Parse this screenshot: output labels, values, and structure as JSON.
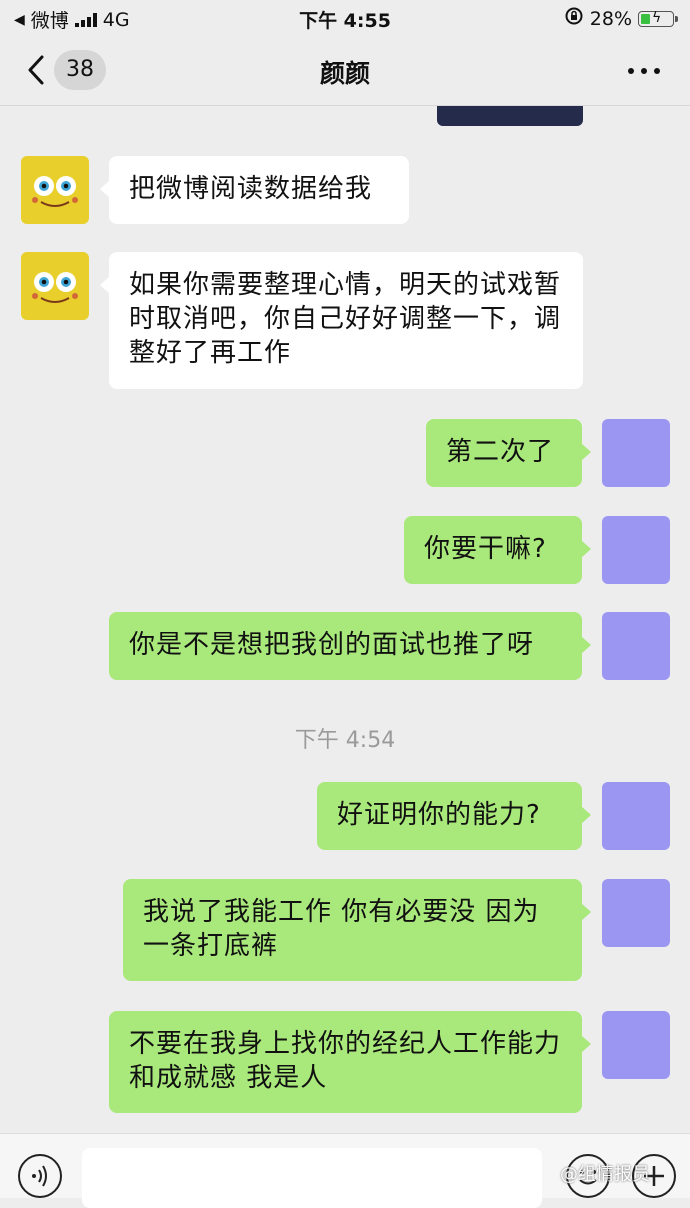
{
  "status_bar": {
    "back_app": "微博",
    "network": "4G",
    "time": "下午 4:55",
    "battery": "28%"
  },
  "nav": {
    "unread_count": "38",
    "title": "颜颜"
  },
  "messages": [
    {
      "side": "in",
      "text": "把微博阅读数据给我"
    },
    {
      "side": "in",
      "text": "如果你需要整理心情，明天的试戏暂时取消吧，你自己好好调整一下，调整好了再工作"
    },
    {
      "side": "out",
      "text": "第二次了"
    },
    {
      "side": "out",
      "text": "你要干嘛?"
    },
    {
      "side": "out",
      "text": "你是不是想把我创的面试也推了呀"
    },
    {
      "side": "out",
      "text": "好证明你的能力?"
    },
    {
      "side": "out",
      "text": "我说了我能工作 你有必要没 因为一条打底裤"
    },
    {
      "side": "out",
      "text": "不要在我身上找你的经纪人工作能力和成就感 我是人"
    }
  ],
  "timestamp": "下午 4:54",
  "watermark": "@组情报员",
  "colors": {
    "chat_background": "#ededed",
    "outgoing_bubble": "#a9e87b",
    "incoming_bubble": "#ffffff",
    "battery_charge": "#3ac041"
  }
}
